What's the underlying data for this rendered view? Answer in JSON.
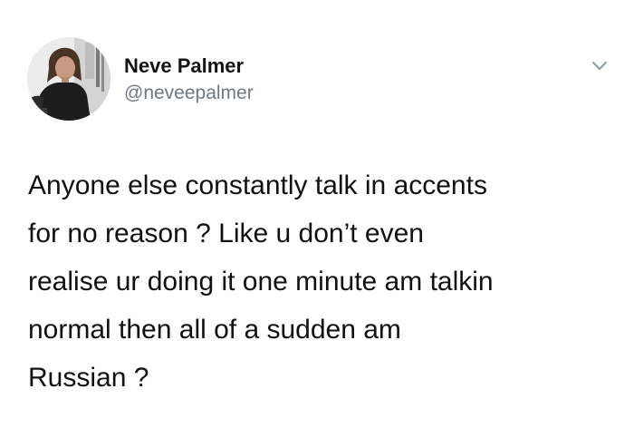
{
  "author": {
    "display_name": "Neve Palmer",
    "handle": "@neveepalmer"
  },
  "icons": {
    "menu": "chevron-down-icon",
    "avatar": "profile-photo"
  },
  "tweet": {
    "lines": [
      "Anyone else constantly talk in accents",
      "for no reason ? Like u don’t even",
      "realise ur doing it one minute am talkin",
      "normal then all of a sudden am",
      "Russian ?"
    ]
  },
  "colors": {
    "name": "#141414",
    "handle": "#6f7880",
    "text": "#111111",
    "chevron": "#8a9aa6"
  }
}
